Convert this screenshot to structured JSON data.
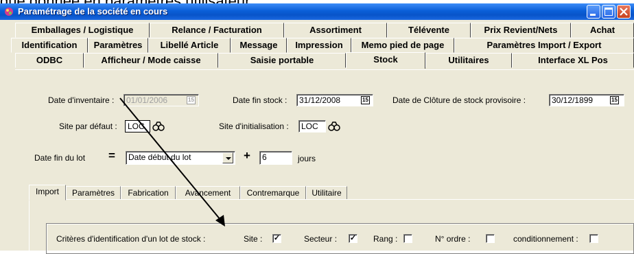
{
  "caption": "que donnée en paramètres utilisateur :",
  "window": {
    "title": "Paramétrage de la société en cours"
  },
  "tab_rows": [
    [
      "Emballages / Logistique",
      "Relance / Facturation",
      "Assortiment",
      "Télévente",
      "Prix Revient/Nets",
      "Achat"
    ],
    [
      "Identification",
      "Paramètres",
      "Libellé Article",
      "Message",
      "Impression",
      "Memo pied de page",
      "Paramètres Import / Export"
    ],
    [
      "ODBC",
      "Afficheur / Mode caisse",
      "Saisie portable",
      "Stock",
      "Utilitaires",
      "Interface XL Pos"
    ]
  ],
  "active_tab": "Stock",
  "stock": {
    "date_inventaire_label": "Date d'inventaire :",
    "date_inventaire_value": "01/01/2006",
    "date_fin_stock_label": "Date fin stock :",
    "date_fin_stock_value": "31/12/2008",
    "date_cloture_label": "Date de Clôture de stock provisoire :",
    "date_cloture_value": "30/12/1899",
    "site_defaut_label": "Site par défaut :",
    "site_defaut_value": "LOC",
    "site_init_label": "Site d'initialisation :",
    "site_init_value": "LOC",
    "date_fin_lot_label": "Date fin du lot",
    "equals": "=",
    "date_debut_lot_value": "Date début du lot",
    "plus": "+",
    "jours_value": "6",
    "jours_label": "jours",
    "calendar_glyph": "15"
  },
  "subtabs": [
    "Import",
    "Paramètres",
    "Fabrication",
    "Avancement",
    "Contremarque",
    "Utilitaire"
  ],
  "active_subtab": "Import",
  "criteres": {
    "label": "Critères d'identification d'un lot de stock :",
    "site_label": "Site :",
    "site_checked": true,
    "secteur_label": "Secteur :",
    "secteur_checked": true,
    "rang_label": "Rang :",
    "rang_checked": false,
    "ordre_label": "N° ordre :",
    "ordre_checked": false,
    "conditionnement_label": "conditionnement :",
    "conditionnement_checked": false,
    "check_glyph": "✓"
  },
  "icons": {
    "app": "app-icon",
    "lookup": "binoculars-icon",
    "annotation": "arrow-annotation"
  },
  "colors": {
    "titlebar": "#0a5fd8",
    "face": "#ece9d8",
    "arrow": "#000000"
  }
}
